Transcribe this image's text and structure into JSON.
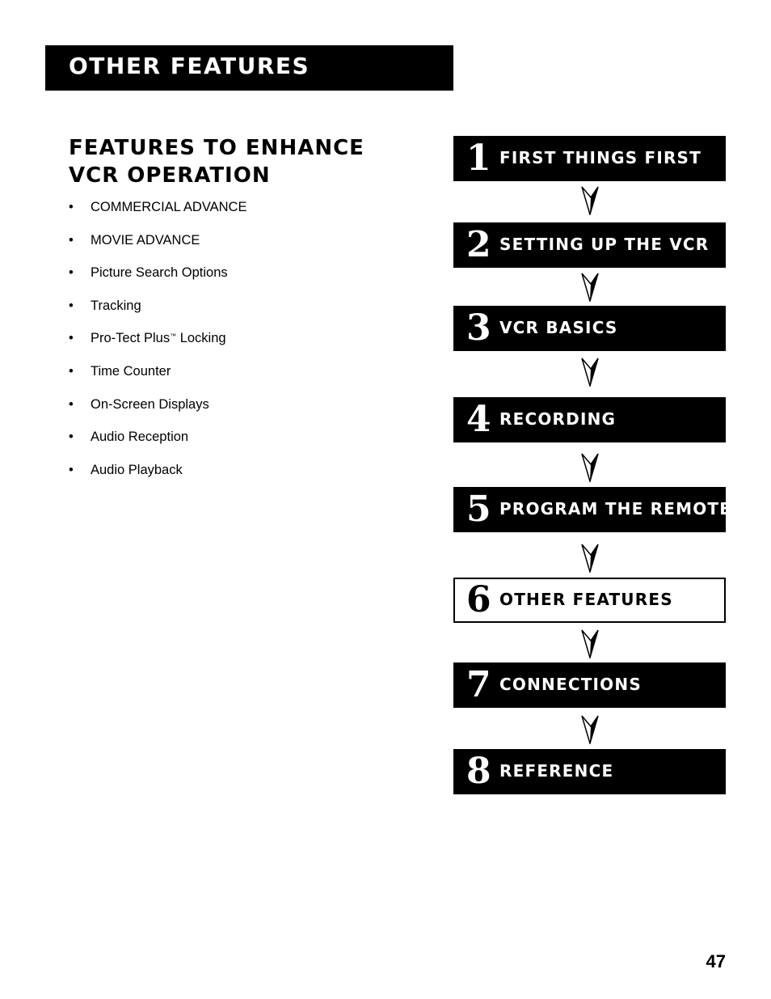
{
  "header": {
    "title": "Other Features"
  },
  "section": {
    "title": "Features to Enhance VCR Operation",
    "items": [
      {
        "bullet": "•",
        "text": "COMMERCIAL ADVANCE"
      },
      {
        "bullet": "•",
        "text": "MOVIE ADVANCE"
      },
      {
        "bullet": "•",
        "text": "Picture Search Options"
      },
      {
        "bullet": "•",
        "text": "Tracking"
      },
      {
        "bullet": "•",
        "text": "Pro-Tect Plus",
        "trademark": "™",
        "suffix": " Locking"
      },
      {
        "bullet": "•",
        "text": "Time Counter"
      },
      {
        "bullet": "•",
        "text": "On-Screen Displays"
      },
      {
        "bullet": "•",
        "text": "Audio Reception"
      },
      {
        "bullet": "•",
        "text": "Audio Playback"
      }
    ]
  },
  "chapters": [
    {
      "number": "1",
      "label": "First Things First",
      "current": false
    },
    {
      "number": "2",
      "label": "Setting Up the VCR",
      "current": false
    },
    {
      "number": "3",
      "label": "VCR Basics",
      "current": false
    },
    {
      "number": "4",
      "label": "Recording",
      "current": false
    },
    {
      "number": "5",
      "label": "Program the Remote",
      "current": false
    },
    {
      "number": "6",
      "label": "Other Features",
      "current": true
    },
    {
      "number": "7",
      "label": "Connections",
      "current": false
    },
    {
      "number": "8",
      "label": "Reference",
      "current": false
    }
  ],
  "icons": {
    "flow_arrow": "arrow-down-icon"
  },
  "colors": {
    "banner_bg": "#000000",
    "banner_text": "#ffffff",
    "page_bg": "#ffffff"
  },
  "footer": {
    "page_number": "47"
  }
}
